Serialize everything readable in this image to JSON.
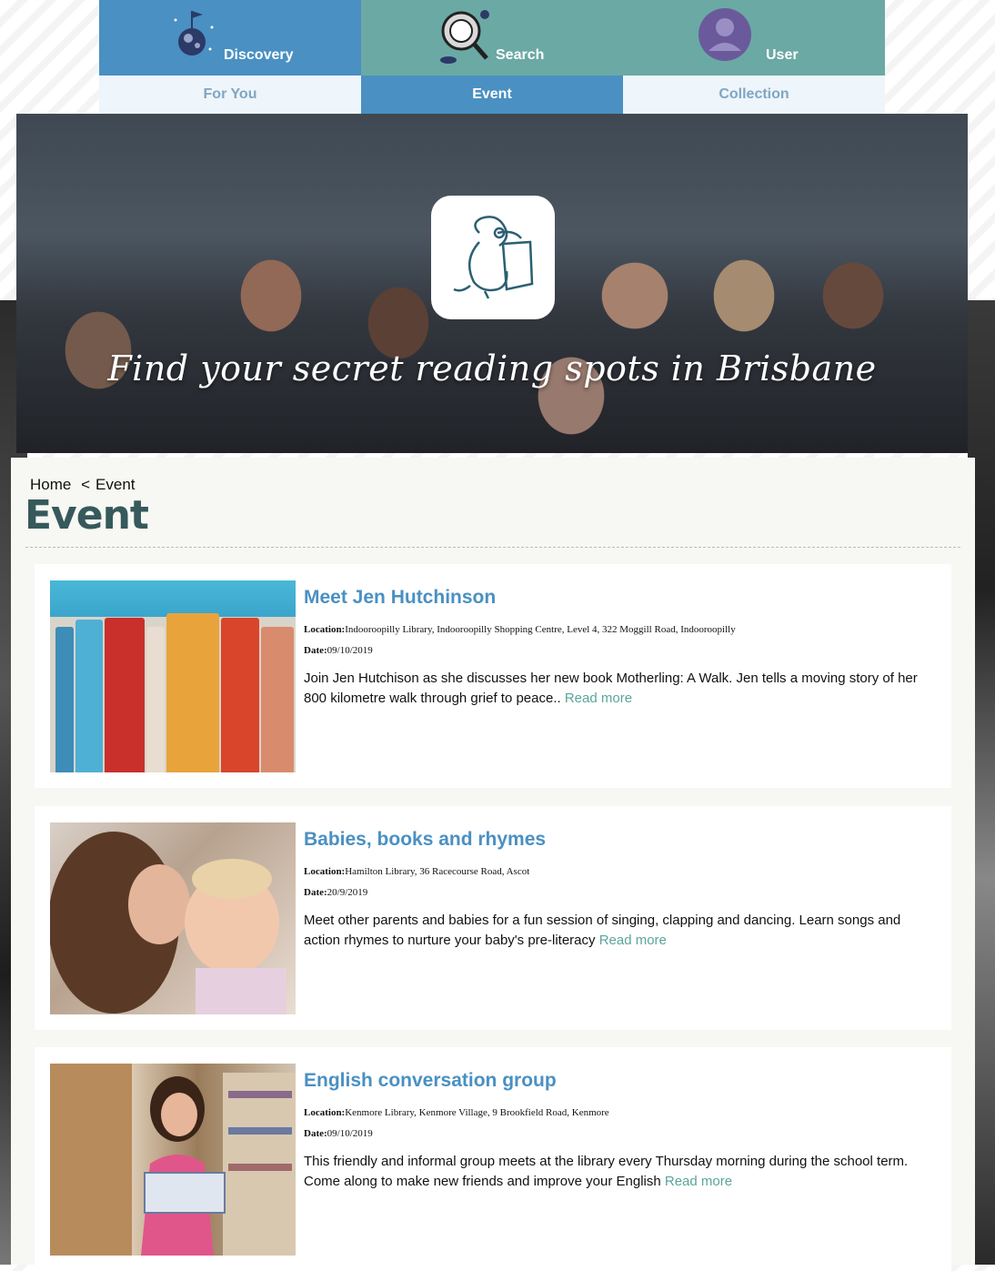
{
  "nav": {
    "tabs": [
      {
        "label": "Discovery",
        "icon": "planet-flag-icon"
      },
      {
        "label": "Search",
        "icon": "magnifier-astronaut-icon"
      },
      {
        "label": "User",
        "icon": "user-avatar-icon"
      }
    ],
    "subtabs": [
      {
        "label": "For You",
        "active": false
      },
      {
        "label": "Event",
        "active": true
      },
      {
        "label": "Collection",
        "active": false
      }
    ]
  },
  "hero": {
    "tagline": "Find your secret reading spots in Brisbane",
    "logo_icon": "platypus-reading-icon"
  },
  "breadcrumb": {
    "home": "Home",
    "separator": "<",
    "current": "Event"
  },
  "page_title": "Event",
  "labels": {
    "location": "Location:",
    "date": "Date:",
    "read_more": "Read more"
  },
  "events": [
    {
      "title": "Meet Jen Hutchinson",
      "location": "Indooroopilly Library, Indooroopilly Shopping Centre, Level 4, 322 Moggill Road, Indooroopilly",
      "date": "09/10/2019",
      "description": "Join Jen Hutchison as she discusses her new book Motherling: A Walk. Jen tells a moving story of her 800 kilometre walk through grief to peace..",
      "image": "books-on-shelf"
    },
    {
      "title": "Babies, books and rhymes",
      "location": "Hamilton Library, 36 Racecourse Road, Ascot",
      "date": "20/9/2019",
      "description": "Meet other parents and babies for a fun session of singing, clapping and dancing. Learn songs and action rhymes to nurture your baby's pre-literacy",
      "image": "mother-and-baby"
    },
    {
      "title": "English conversation group",
      "location": "Kenmore Library, Kenmore Village, 9 Brookfield Road, Kenmore",
      "date": "09/10/2019",
      "description": "This friendly and informal group meets at the library every Thursday morning during the school term. Come along to make new friends and improve your English",
      "image": "woman-reading-in-library"
    }
  ],
  "colors": {
    "primary": "#4a90c2",
    "teal": "#6ba9a4",
    "title": "#36595b",
    "link": "#5aa59c"
  }
}
